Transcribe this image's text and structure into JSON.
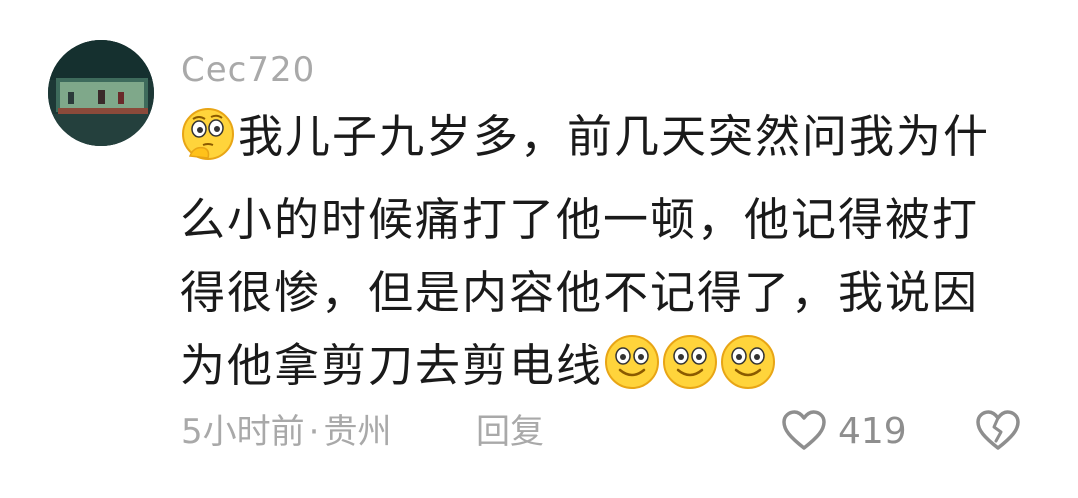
{
  "comment": {
    "username": "Cec720",
    "text_parts": [
      "我儿子九岁多，前几天突然问我为什么小的时候痛打了他一顿，他记得被打得很惨，但是内容他不记得了，我说因为他拿剪刀去剪电线"
    ],
    "leading_emoji": "thinking-emoji",
    "trailing_emojis": [
      "smile-emoji",
      "smile-emoji",
      "smile-emoji"
    ],
    "time": "5小时前",
    "separator": "·",
    "location": "贵州",
    "reply_label": "回复",
    "like_count": "419"
  },
  "colors": {
    "meta": "#a9a9a9",
    "text": "#1a1a1a",
    "emoji_yellow": "#ffd43b",
    "emoji_outline": "#e8a515"
  }
}
